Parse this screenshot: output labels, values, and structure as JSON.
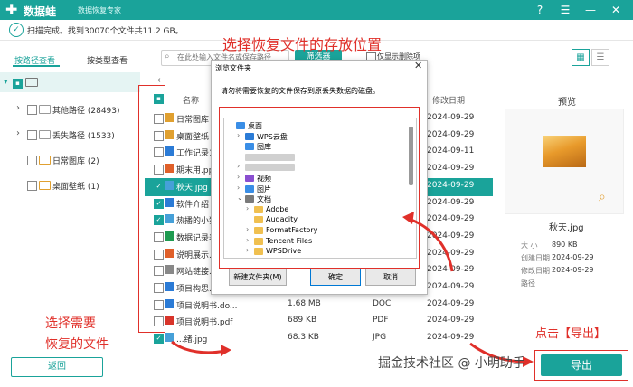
{
  "app": {
    "name": "数据蛙",
    "subtitle": "数据恢复专家",
    "window_buttons": [
      "?",
      "☰",
      "—",
      "✕"
    ]
  },
  "status": {
    "text": "扫描完成。找到30070个文件共11.2 GB。"
  },
  "tabs": [
    {
      "label": "按路径查看",
      "active": true
    },
    {
      "label": "按类型查看",
      "active": false
    }
  ],
  "toolbar": {
    "search_placeholder": "在此处输入文件名或保存路径",
    "filter_label": "筛选器",
    "show_deleted_label": "仅显示删除项"
  },
  "tree": [
    {
      "label": "其他路径 (28493)",
      "expandable": true
    },
    {
      "label": "丢失路径 (1533)",
      "expandable": true
    },
    {
      "label": "日常图库 (2)",
      "expandable": false
    },
    {
      "label": "桌面壁纸 (1)",
      "expandable": false
    }
  ],
  "list": {
    "col_name": "名称",
    "col_modified": "修改日期",
    "rows": [
      {
        "name": "日常图库",
        "size": "",
        "type": "",
        "date": "2024-09-29",
        "checked": false,
        "icon": "folder"
      },
      {
        "name": "桌面壁纸",
        "size": "",
        "type": "",
        "date": "2024-09-29",
        "checked": false,
        "icon": "folder"
      },
      {
        "name": "工作记录1",
        "size": "",
        "type": "",
        "date": "2024-09-11",
        "checked": false,
        "icon": "doc"
      },
      {
        "name": "期末用.ppt",
        "size": "",
        "type": "",
        "date": "2024-09-29",
        "checked": false,
        "icon": "ppt"
      },
      {
        "name": "秋天.jpg",
        "size": "",
        "type": "",
        "date": "2024-09-29",
        "checked": true,
        "icon": "img",
        "selected": true
      },
      {
        "name": "软件介绍",
        "size": "",
        "type": "",
        "date": "2024-09-29",
        "checked": true,
        "icon": "doc"
      },
      {
        "name": "热播的小猫",
        "size": "",
        "type": "",
        "date": "2024-09-29",
        "checked": true,
        "icon": "img"
      },
      {
        "name": "数据记录表",
        "size": "",
        "type": "",
        "date": "2024-09-29",
        "checked": false,
        "icon": "xls"
      },
      {
        "name": "说明展示.p",
        "size": "",
        "type": "",
        "date": "2024-09-29",
        "checked": false,
        "icon": "ppt"
      },
      {
        "name": "网站链接.t",
        "size": "",
        "type": "",
        "date": "2024-09-29",
        "checked": false,
        "icon": "txt"
      },
      {
        "name": "项目构思.docx",
        "size": "",
        "type": "",
        "date": "2024-09-29",
        "checked": false,
        "icon": "doc"
      },
      {
        "name": "项目说明书.do...",
        "size": "1.68 MB",
        "type": "DOC",
        "date": "2024-09-29",
        "checked": false,
        "icon": "doc"
      },
      {
        "name": "项目说明书.pdf",
        "size": "689 KB",
        "type": "PDF",
        "date": "2024-09-29",
        "checked": false,
        "icon": "pdf"
      },
      {
        "name": "...绪.jpg",
        "size": "68.3 KB",
        "type": "JPG",
        "date": "2024-09-29",
        "checked": true,
        "icon": "img"
      }
    ]
  },
  "preview": {
    "title": "预览",
    "file_name": "秋天.jpg",
    "meta": [
      {
        "k": "大 小",
        "v": "890 KB"
      },
      {
        "k": "创建日期",
        "v": "2024-09-29"
      },
      {
        "k": "修改日期",
        "v": "2024-09-29"
      },
      {
        "k": "路径",
        "v": ""
      }
    ]
  },
  "dialog": {
    "title": "浏览文件夹",
    "close": "✕",
    "message": "请勿将需要恢复的文件保存到原丢失数据的磁盘。",
    "nodes": [
      {
        "label": "桌面",
        "indent": 0,
        "arrow": "",
        "icon": "desktop"
      },
      {
        "label": "WPS云盘",
        "indent": 1,
        "arrow": "›",
        "icon": "cloud"
      },
      {
        "label": "图库",
        "indent": 1,
        "arrow": "",
        "icon": "gallery"
      },
      {
        "label": "",
        "indent": 1,
        "arrow": "",
        "icon": "blur"
      },
      {
        "label": "",
        "indent": 1,
        "arrow": "›",
        "icon": "blur"
      },
      {
        "label": "视频",
        "indent": 1,
        "arrow": "›",
        "icon": "video"
      },
      {
        "label": "图片",
        "indent": 1,
        "arrow": "›",
        "icon": "picture"
      },
      {
        "label": "文档",
        "indent": 1,
        "arrow": "⌄",
        "icon": "docs"
      },
      {
        "label": "Adobe",
        "indent": 2,
        "arrow": "›",
        "icon": "folder"
      },
      {
        "label": "Audacity",
        "indent": 2,
        "arrow": "",
        "icon": "folder"
      },
      {
        "label": "FormatFactory",
        "indent": 2,
        "arrow": "›",
        "icon": "folder"
      },
      {
        "label": "Tencent Files",
        "indent": 2,
        "arrow": "›",
        "icon": "folder"
      },
      {
        "label": "WPSDrive",
        "indent": 2,
        "arrow": "›",
        "icon": "folder"
      }
    ],
    "new_folder": "新建文件夹(M)",
    "ok": "确定",
    "cancel": "取消"
  },
  "bottom": {
    "back": "返回",
    "export": "导出"
  },
  "annotations": {
    "top": "选择恢复文件的存放位置",
    "left1": "选择需要",
    "left2": "恢复的文件",
    "right": "点击【导出】"
  },
  "watermark": "掘金技术社区 @ 小明助手",
  "colors": {
    "accent": "#1aa39a",
    "annotation": "#e0302a"
  }
}
